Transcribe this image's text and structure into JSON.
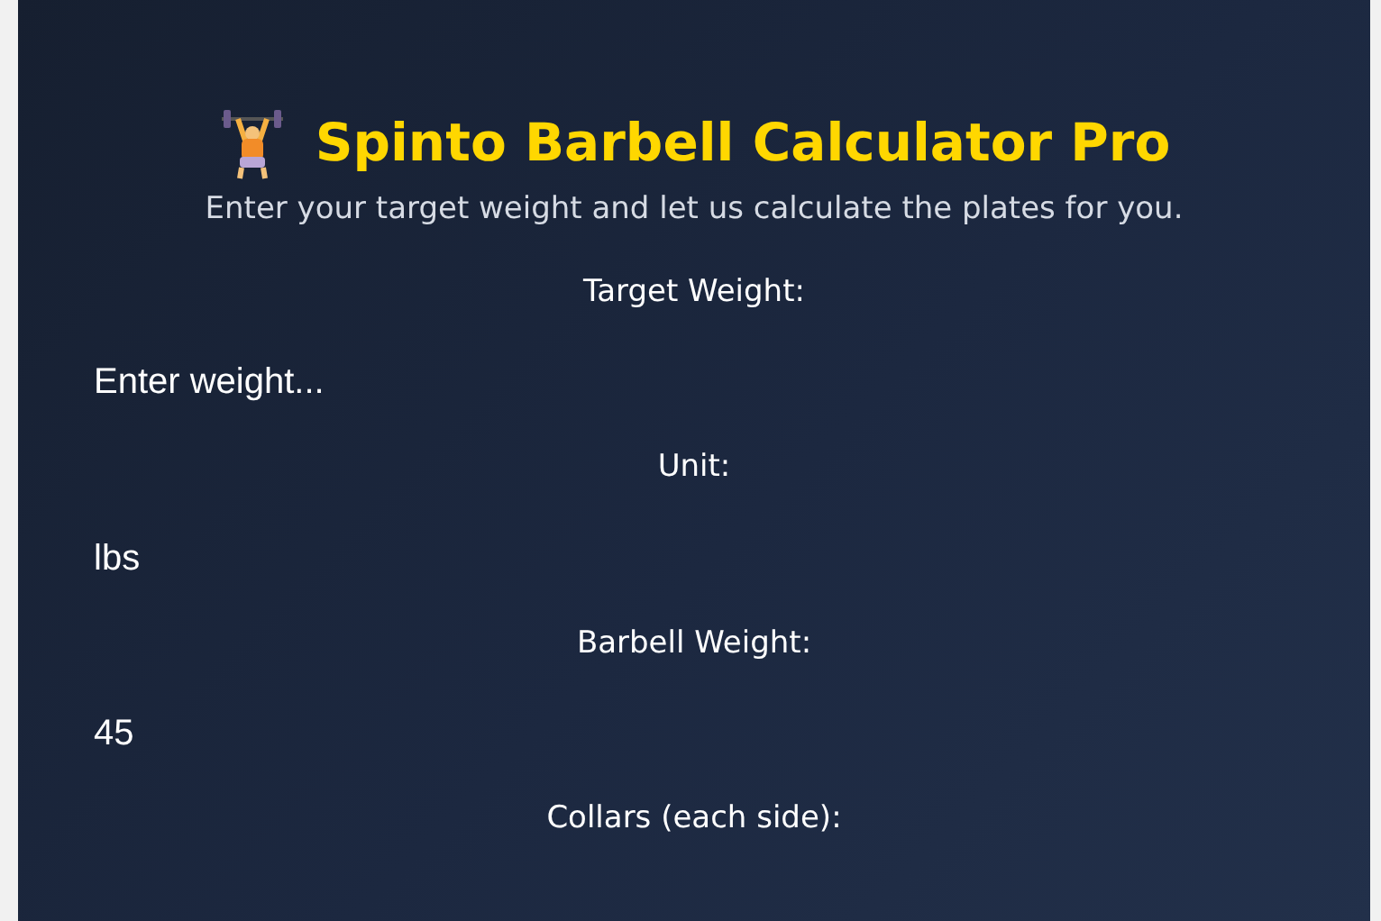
{
  "header": {
    "title": "Spinto Barbell Calculator Pro",
    "subtitle": "Enter your target weight and let us calculate the plates for you."
  },
  "fields": [
    {
      "label": "Target Weight:",
      "kind": "input",
      "placeholder": "Enter weight..."
    },
    {
      "label": "Unit:",
      "kind": "select",
      "value": "lbs"
    },
    {
      "label": "Barbell Weight:",
      "kind": "input",
      "value": "45"
    },
    {
      "label": "Collars (each side):"
    }
  ]
}
